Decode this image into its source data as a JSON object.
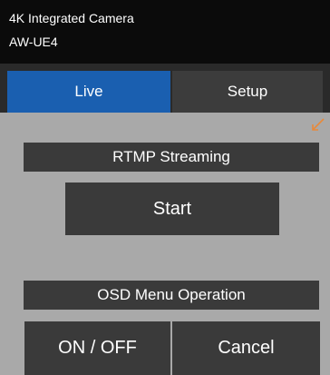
{
  "header": {
    "line1": "4K Integrated Camera",
    "line2": "AW-UE4"
  },
  "tabs": [
    {
      "label": "Live",
      "selected": true
    },
    {
      "label": "Setup",
      "selected": false
    }
  ],
  "rtmp": {
    "title": "RTMP Streaming",
    "start_label": "Start"
  },
  "osd": {
    "title": "OSD Menu Operation",
    "on_off_label": "ON / OFF",
    "cancel_label": "Cancel"
  },
  "colors": {
    "selected_tab": "#1a5fb0",
    "panel": "#3a3a3a",
    "background": "#a9a9a9",
    "arrow": "#e8893a"
  },
  "icons": {
    "pointer": "arrow-pointer-icon"
  }
}
